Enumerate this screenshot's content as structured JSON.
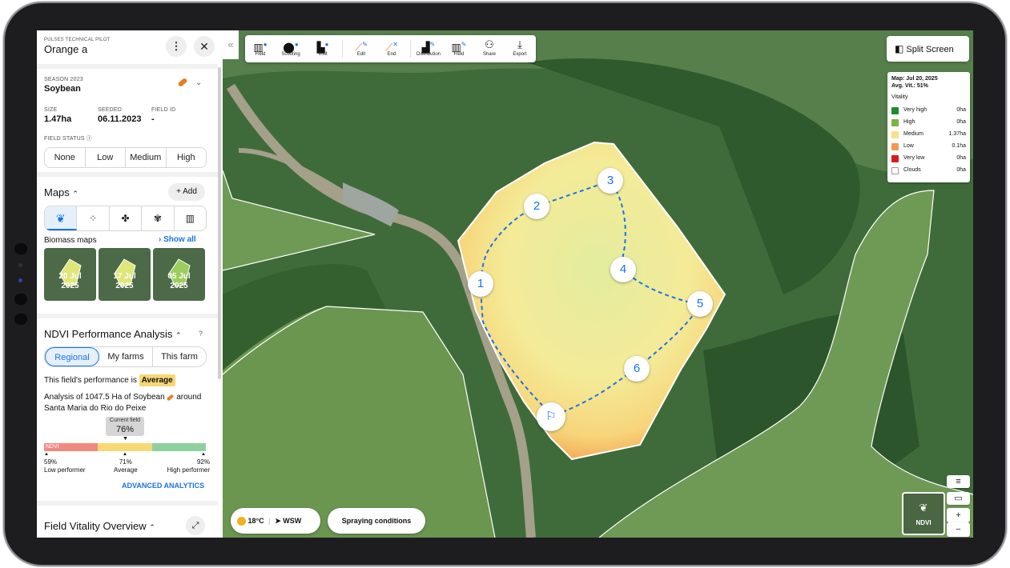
{
  "panel": {
    "pilot_label": "PULSES TECHNICAL PILOT",
    "field_name": "Orange a",
    "season_label": "SEASON 2023",
    "crop": "Soybean",
    "size_label": "SIZE",
    "size_value": "1.47ha",
    "seeded_label": "SEEDED",
    "seeded_value": "06.11.2023",
    "field_id_label": "FIELD ID",
    "field_id_value": "-",
    "field_status_label": "FIELD STATUS",
    "field_status_options": [
      "None",
      "Low",
      "Medium",
      "High"
    ],
    "maps_title": "Maps",
    "add_label": "Add",
    "biomass_label": "Biomass maps",
    "show_all": "Show all",
    "thumbnails": [
      {
        "day": "20 Jul",
        "year": "2025"
      },
      {
        "day": "17 Jul",
        "year": "2025"
      },
      {
        "day": "05 Jul",
        "year": "2025"
      }
    ],
    "ndvi_title": "NDVI Performance Analysis",
    "ndvi_tabs": [
      "Regional",
      "My farms",
      "This farm"
    ],
    "perf_text": "This field's performance is",
    "perf_badge": "Average",
    "analysis_line1": "Analysis of 1047.5 Ha of Soybean",
    "analysis_line1_end": "around",
    "analysis_line2": "Santa Maria do Rio do Peixe",
    "current_field_label": "Current field",
    "current_field_value": "76%",
    "ndvi_bar_label": "NDVI",
    "scale": [
      {
        "pct": "59%",
        "name": "Low performer"
      },
      {
        "pct": "71%",
        "name": "Average"
      },
      {
        "pct": "92%",
        "name": "High performer"
      }
    ],
    "advanced": "ADVANCED ANALYTICS",
    "vitality_title": "Field Vitality Overview"
  },
  "toolbar": {
    "groups": [
      [
        {
          "label": "Field",
          "icon": "map-add-icon"
        },
        {
          "label": "Scouting",
          "icon": "pin-add-icon"
        },
        {
          "label": "Visit",
          "icon": "boot-add-icon"
        }
      ],
      [
        {
          "label": "Edit",
          "icon": "carrot-edit-icon"
        },
        {
          "label": "End",
          "icon": "carrot-end-icon"
        }
      ],
      [
        {
          "label": "Distribution",
          "icon": "chart-edit-icon"
        },
        {
          "label": "Field",
          "icon": "map-edit-icon"
        },
        {
          "label": "Share",
          "icon": "share-user-icon"
        },
        {
          "label": "Export",
          "icon": "export-icon"
        }
      ]
    ]
  },
  "split_screen": "Split Screen",
  "legend": {
    "map_date": "Map: Jul 20, 2025",
    "avg_vit": "Avg. Vit.: 51%",
    "title": "Vitality",
    "rows": [
      {
        "name": "Very high",
        "value": "0ha",
        "color": "#1e8a2e"
      },
      {
        "name": "High",
        "value": "0ha",
        "color": "#7cb342"
      },
      {
        "name": "Medium",
        "value": "1.37ha",
        "color": "#f5e28a"
      },
      {
        "name": "Low",
        "value": "0.1ha",
        "color": "#f39a4e"
      },
      {
        "name": "Very low",
        "value": "0ha",
        "color": "#d81b1b"
      },
      {
        "name": "Clouds",
        "value": "0ha",
        "color": "#ffffff"
      }
    ]
  },
  "weather": {
    "temp": "18°C",
    "wind": "WSW",
    "spraying": "Spraying conditions"
  },
  "waypoints": [
    "1",
    "2",
    "3",
    "4",
    "5",
    "6"
  ],
  "ndvi_thumb_label": "NDVI",
  "colors": {
    "accent": "#1a73e8",
    "average_badge": "#f8d775",
    "bar_low": "#ef8a80",
    "bar_mid": "#f8d775",
    "bar_high": "#8fd19e"
  }
}
